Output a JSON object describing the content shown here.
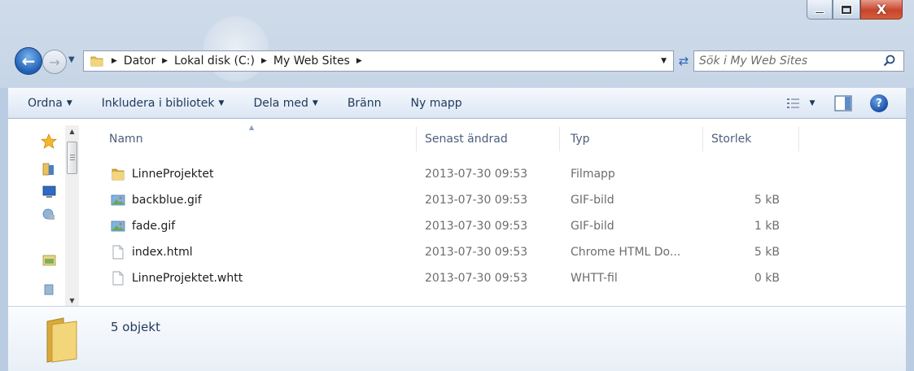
{
  "window": {
    "minimize_icon": "minimize-icon",
    "maximize_icon": "maximize-icon",
    "close_glyph": "X"
  },
  "nav": {
    "breadcrumbs": [
      "Dator",
      "Lokal disk (C:)",
      "My Web Sites"
    ],
    "search_placeholder": "Sök i My Web Sites"
  },
  "toolbar": {
    "ordna": "Ordna",
    "inkludera": "Inkludera i bibliotek",
    "dela": "Dela med",
    "brann": "Bränn",
    "ny_mapp": "Ny mapp"
  },
  "columns": {
    "name": "Namn",
    "date": "Senast ändrad",
    "type": "Typ",
    "size": "Storlek"
  },
  "files": [
    {
      "name": "LinneProjektet",
      "date": "2013-07-30 09:53",
      "type": "Filmapp",
      "size": "",
      "icon": "folder-icon"
    },
    {
      "name": "backblue.gif",
      "date": "2013-07-30 09:53",
      "type": "GIF-bild",
      "size": "5 kB",
      "icon": "image-file-icon"
    },
    {
      "name": "fade.gif",
      "date": "2013-07-30 09:53",
      "type": "GIF-bild",
      "size": "1 kB",
      "icon": "image-file-icon"
    },
    {
      "name": "index.html",
      "date": "2013-07-30 09:53",
      "type": "Chrome HTML Do...",
      "size": "5 kB",
      "icon": "document-icon"
    },
    {
      "name": "LinneProjektet.whtt",
      "date": "2013-07-30 09:53",
      "type": "WHTT-fil",
      "size": "0 kB",
      "icon": "document-icon"
    }
  ],
  "details": {
    "count": "5 objekt"
  },
  "colors": {
    "accent": "#1e395b",
    "folder": "#e8c25a",
    "close": "#c7452c"
  }
}
